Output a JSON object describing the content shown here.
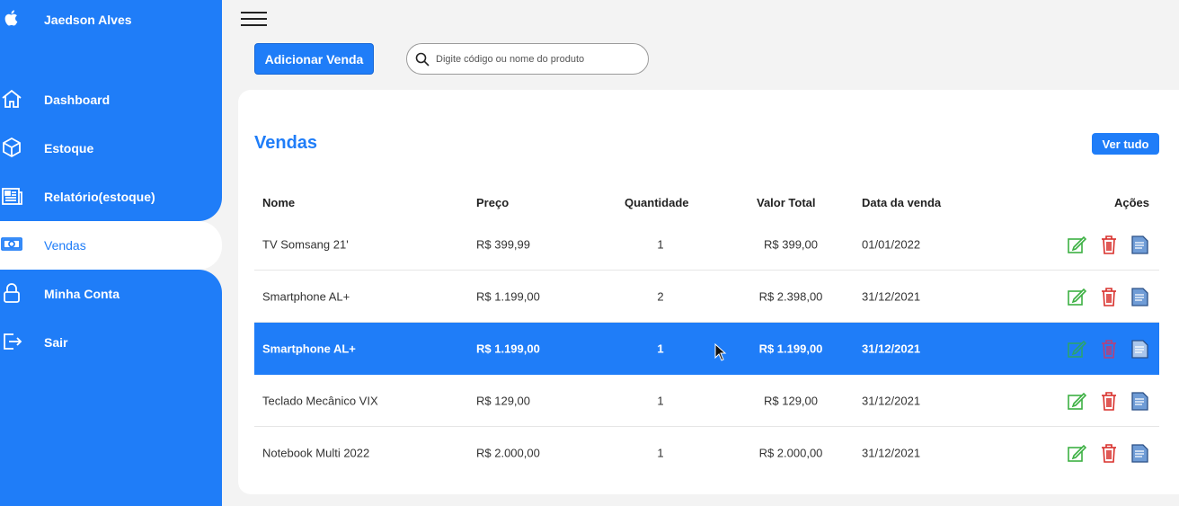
{
  "sidebar": {
    "user_name": "Jaedson Alves",
    "items": [
      {
        "label": "Dashboard",
        "icon": "home-icon"
      },
      {
        "label": "Estoque",
        "icon": "box-icon"
      },
      {
        "label": "Relatório(estoque)",
        "icon": "report-icon"
      },
      {
        "label": "Vendas",
        "icon": "money-icon",
        "active": true
      },
      {
        "label": "Minha Conta",
        "icon": "lock-icon"
      },
      {
        "label": "Sair",
        "icon": "logout-icon"
      }
    ]
  },
  "toolbar": {
    "add_label": "Adicionar Venda",
    "search_placeholder": "Digite código ou nome do produto"
  },
  "sales": {
    "title": "Vendas",
    "view_all_label": "Ver tudo",
    "columns": {
      "nome": "Nome",
      "preco": "Preço",
      "quantidade": "Quantidade",
      "valor_total": "Valor Total",
      "data": "Data da venda",
      "acoes": "Ações"
    },
    "rows": [
      {
        "nome": "TV Somsang 21'",
        "preco": "R$ 399,99",
        "quantidade": "1",
        "valor_total": "R$ 399,00",
        "data": "01/01/2022"
      },
      {
        "nome": "Smartphone AL+",
        "preco": "R$ 1.199,00",
        "quantidade": "2",
        "valor_total": "R$ 2.398,00",
        "data": "31/12/2021"
      },
      {
        "nome": "Smartphone AL+",
        "preco": "R$ 1.199,00",
        "quantidade": "1",
        "valor_total": "R$ 1.199,00",
        "data": "31/12/2021",
        "selected": true
      },
      {
        "nome": "Teclado Mecânico VIX",
        "preco": "R$ 129,00",
        "quantidade": "1",
        "valor_total": "R$ 129,00",
        "data": "31/12/2021"
      },
      {
        "nome": "Notebook Multi 2022",
        "preco": "R$ 2.000,00",
        "quantidade": "1",
        "valor_total": "R$ 2.000,00",
        "data": "31/12/2021"
      }
    ]
  },
  "colors": {
    "primary": "#1f7df8",
    "edit": "#3cb043",
    "delete": "#d9302c",
    "document": "#3a6fb5"
  }
}
